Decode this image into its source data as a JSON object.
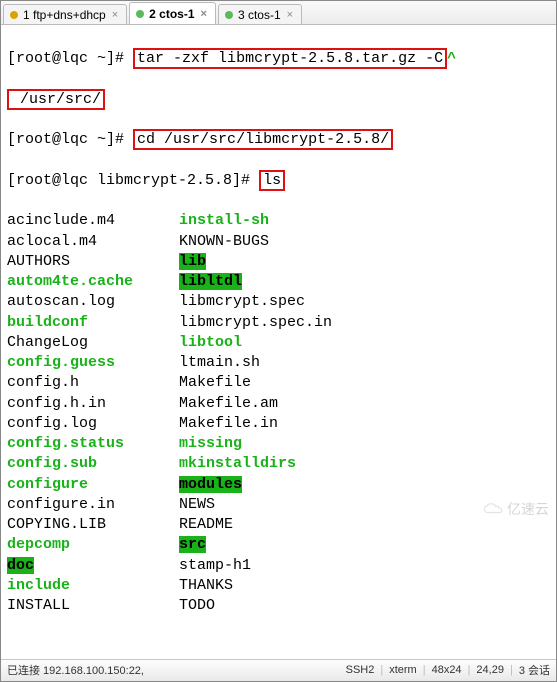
{
  "tabs": [
    {
      "label": "1 ftp+dns+dhcp",
      "dot": "amber"
    },
    {
      "label": "2 ctos-1",
      "dot": "green"
    },
    {
      "label": "3 ctos-1",
      "dot": "green"
    }
  ],
  "prompts": {
    "p1_user": "[root@lqc ~]#",
    "p1_cmd_a": "tar -zxf libmcrypt-2.5.8.tar.gz -C",
    "p1_cmd_b": " /usr/src/",
    "p2_user": "[root@lqc ~]#",
    "p2_cmd": "cd /usr/src/libmcrypt-2.5.8/",
    "p3_user": "[root@lqc libmcrypt-2.5.8]#",
    "p3_cmd": "ls"
  },
  "ls": [
    {
      "c1": "acinclude.m4",
      "s1": "plain",
      "c2": "install-sh",
      "s2": "green"
    },
    {
      "c1": "aclocal.m4",
      "s1": "plain",
      "c2": "KNOWN-BUGS",
      "s2": "plain"
    },
    {
      "c1": "AUTHORS",
      "s1": "plain",
      "c2": "lib",
      "s2": "green-hl"
    },
    {
      "c1": "autom4te.cache",
      "s1": "green",
      "c2": "libltdl",
      "s2": "green-hl"
    },
    {
      "c1": "autoscan.log",
      "s1": "plain",
      "c2": "libmcrypt.spec",
      "s2": "plain"
    },
    {
      "c1": "buildconf",
      "s1": "green",
      "c2": "libmcrypt.spec.in",
      "s2": "plain"
    },
    {
      "c1": "ChangeLog",
      "s1": "plain",
      "c2": "libtool",
      "s2": "green"
    },
    {
      "c1": "config.guess",
      "s1": "green",
      "c2": "ltmain.sh",
      "s2": "plain"
    },
    {
      "c1": "config.h",
      "s1": "plain",
      "c2": "Makefile",
      "s2": "plain"
    },
    {
      "c1": "config.h.in",
      "s1": "plain",
      "c2": "Makefile.am",
      "s2": "plain"
    },
    {
      "c1": "config.log",
      "s1": "plain",
      "c2": "Makefile.in",
      "s2": "plain"
    },
    {
      "c1": "config.status",
      "s1": "green",
      "c2": "missing",
      "s2": "green"
    },
    {
      "c1": "config.sub",
      "s1": "green",
      "c2": "mkinstalldirs",
      "s2": "green"
    },
    {
      "c1": "configure",
      "s1": "green",
      "c2": "modules",
      "s2": "green-hl"
    },
    {
      "c1": "configure.in",
      "s1": "plain",
      "c2": "NEWS",
      "s2": "plain"
    },
    {
      "c1": "COPYING.LIB",
      "s1": "plain",
      "c2": "README",
      "s2": "plain"
    },
    {
      "c1": "depcomp",
      "s1": "green",
      "c2": "src",
      "s2": "green-hl"
    },
    {
      "c1": "doc",
      "s1": "green-hl",
      "c2": "stamp-h1",
      "s2": "plain"
    },
    {
      "c1": "include",
      "s1": "green",
      "c2": "THANKS",
      "s2": "plain"
    },
    {
      "c1": "INSTALL",
      "s1": "plain",
      "c2": "TODO",
      "s2": "plain"
    }
  ],
  "status": {
    "connected": "已连接 192.168.100.150:22,",
    "ssh": "SSH2",
    "term": "xterm",
    "size": "48x24",
    "pos": "24,29",
    "sessions": "3 会话"
  },
  "watermark": "亿速云",
  "caret": "^"
}
